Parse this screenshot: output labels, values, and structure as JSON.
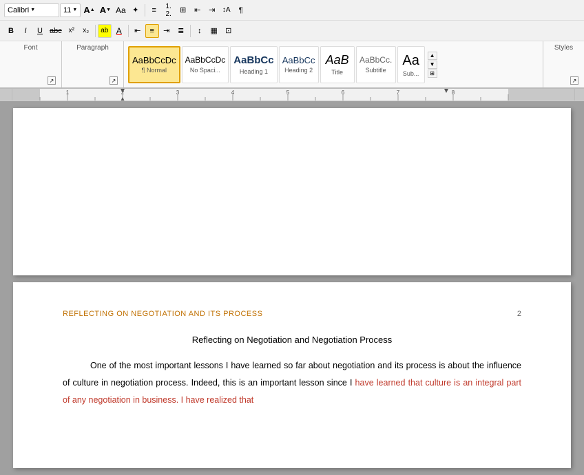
{
  "toolbar": {
    "row1": {
      "buttons": [
        {
          "id": "font-name",
          "label": "A",
          "type": "dropdown",
          "value": "Calibri"
        },
        {
          "id": "font-size",
          "label": "11",
          "type": "dropdown"
        },
        {
          "id": "grow",
          "label": "A↑",
          "title": "Increase Font Size"
        },
        {
          "id": "shrink",
          "label": "A↓",
          "title": "Decrease Font Size"
        },
        {
          "id": "format",
          "label": "Aa",
          "type": "btn"
        },
        {
          "id": "clear-format",
          "label": "✦",
          "type": "btn"
        },
        {
          "id": "sep1",
          "type": "sep"
        },
        {
          "id": "list-bullets",
          "label": "☰",
          "type": "btn"
        },
        {
          "id": "list-numbers",
          "label": "☷",
          "type": "btn"
        },
        {
          "id": "multilevel",
          "label": "⊞",
          "type": "btn"
        },
        {
          "id": "decrease-indent",
          "label": "⇤",
          "type": "btn"
        },
        {
          "id": "increase-indent",
          "label": "⇥",
          "type": "btn"
        },
        {
          "id": "sort",
          "label": "↕A",
          "type": "btn"
        },
        {
          "id": "para-mark",
          "label": "¶",
          "type": "btn"
        }
      ]
    },
    "row2": {
      "buttons": [
        {
          "id": "superscript2",
          "label": "x²",
          "type": "btn"
        },
        {
          "id": "subscript2",
          "label": "x₂",
          "type": "btn"
        },
        {
          "id": "sep2",
          "type": "sep"
        },
        {
          "id": "highlight",
          "label": "ab",
          "type": "btn",
          "highlight": true
        },
        {
          "id": "font-color",
          "label": "A",
          "type": "btn",
          "underline-color": "red"
        },
        {
          "id": "sep3",
          "type": "sep"
        },
        {
          "id": "align-left",
          "label": "≡",
          "type": "btn"
        },
        {
          "id": "align-center",
          "label": "≡",
          "type": "btn",
          "active": true
        },
        {
          "id": "align-right",
          "label": "≡",
          "type": "btn"
        },
        {
          "id": "justify",
          "label": "≡",
          "type": "btn"
        },
        {
          "id": "sep4",
          "type": "sep"
        },
        {
          "id": "line-spacing",
          "label": "↕",
          "type": "btn"
        },
        {
          "id": "shading",
          "label": "▦",
          "type": "btn"
        },
        {
          "id": "borders",
          "label": "⊞",
          "type": "btn"
        }
      ]
    }
  },
  "styles": {
    "label": "Styles",
    "items": [
      {
        "id": "normal",
        "preview": "AaBbCcDc",
        "label": "¶ Normal",
        "active": true
      },
      {
        "id": "no-spacing",
        "preview": "AaBbCcDc",
        "label": "No Spaci..."
      },
      {
        "id": "heading1",
        "preview": "AaBbCc",
        "label": "Heading 1"
      },
      {
        "id": "heading2",
        "preview": "AaBbCc",
        "label": "Heading 2"
      },
      {
        "id": "title",
        "preview": "AaB",
        "label": "Title"
      },
      {
        "id": "subtitle",
        "preview": "AaBbCc.",
        "label": "Subtitle"
      },
      {
        "id": "sub2",
        "preview": "Aa",
        "label": "Sub..."
      }
    ]
  },
  "sections": {
    "font": {
      "label": "Font"
    },
    "paragraph": {
      "label": "Paragraph"
    },
    "styles": {
      "label": "Styles"
    }
  },
  "ruler": {
    "visible": true
  },
  "pages": [
    {
      "id": "page1",
      "blank": true
    },
    {
      "id": "page2",
      "header_title": "REFLECTING ON NEGOTIATION AND ITS PROCESS",
      "header_num": "2",
      "main_title": "Reflecting on Negotiation and Negotiation Process",
      "body_text": "One of the most important lessons I have learned so far about negotiation and its process is about the influence of culture in negotiation process. Indeed, this is an important lesson since I have learned that culture is an integral part of any negotiation in business. I have realized that"
    }
  ]
}
